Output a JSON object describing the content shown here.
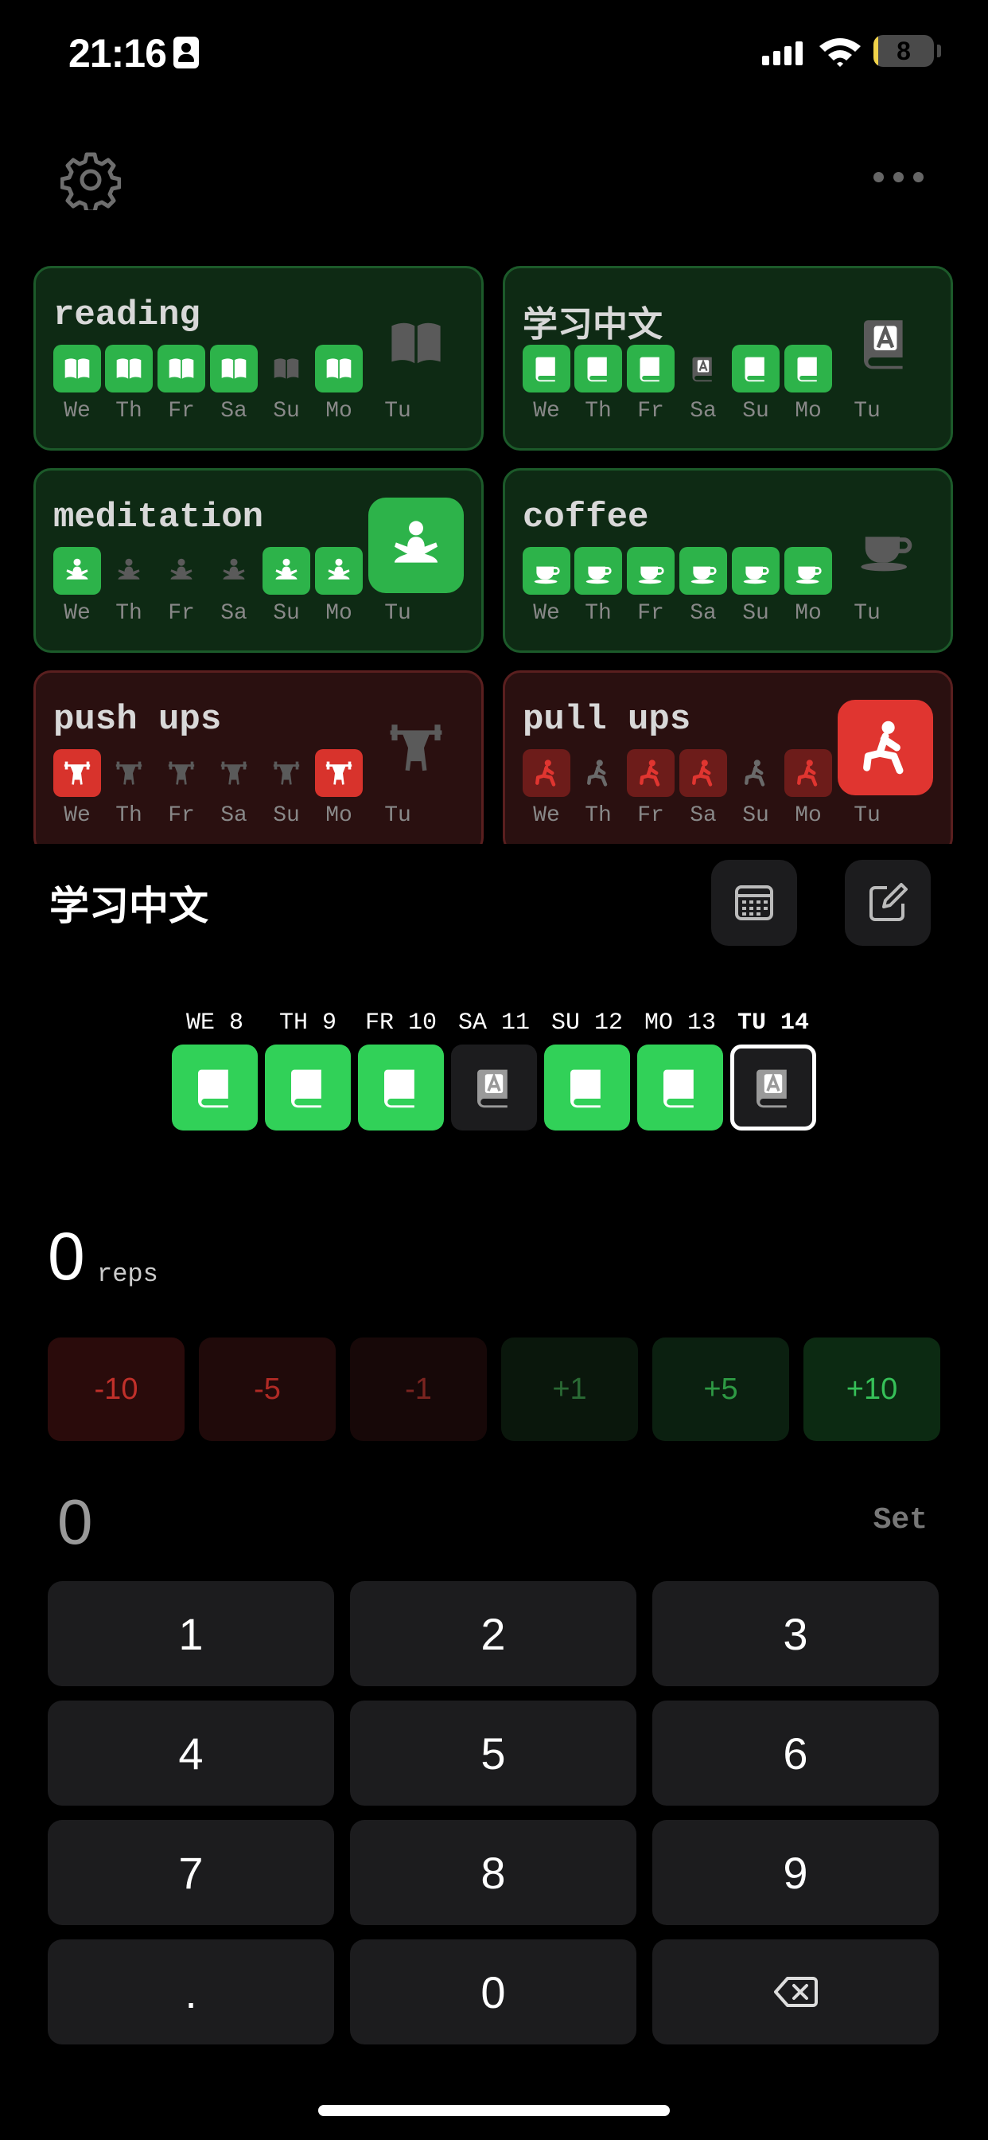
{
  "status_bar": {
    "time": "21:16",
    "battery": "8",
    "battery_level_percent": 8
  },
  "habits": [
    {
      "title": "reading",
      "theme": "green",
      "icon": "book-open-icon",
      "days": [
        {
          "label": "We",
          "done": true
        },
        {
          "label": "Th",
          "done": true
        },
        {
          "label": "Fr",
          "done": true
        },
        {
          "label": "Sa",
          "done": true
        },
        {
          "label": "Su",
          "done": false
        },
        {
          "label": "Mo",
          "done": true
        }
      ],
      "today": {
        "label": "Tu",
        "done": false
      }
    },
    {
      "title": "学习中文",
      "theme": "green",
      "icon": "dictionary-book-icon",
      "days": [
        {
          "label": "We",
          "done": true
        },
        {
          "label": "Th",
          "done": true
        },
        {
          "label": "Fr",
          "done": true
        },
        {
          "label": "Sa",
          "done": false
        },
        {
          "label": "Su",
          "done": true
        },
        {
          "label": "Mo",
          "done": true
        }
      ],
      "today": {
        "label": "Tu",
        "done": false
      }
    },
    {
      "title": "meditation",
      "theme": "green",
      "icon": "meditation-icon",
      "days": [
        {
          "label": "We",
          "done": true
        },
        {
          "label": "Th",
          "done": false
        },
        {
          "label": "Fr",
          "done": false
        },
        {
          "label": "Sa",
          "done": false
        },
        {
          "label": "Su",
          "done": true
        },
        {
          "label": "Mo",
          "done": true
        }
      ],
      "today": {
        "label": "Tu",
        "done": true
      }
    },
    {
      "title": "coffee",
      "theme": "green",
      "icon": "coffee-cup-icon",
      "days": [
        {
          "label": "We",
          "done": true
        },
        {
          "label": "Th",
          "done": true
        },
        {
          "label": "Fr",
          "done": true
        },
        {
          "label": "Sa",
          "done": true
        },
        {
          "label": "Su",
          "done": true
        },
        {
          "label": "Mo",
          "done": true
        }
      ],
      "today": {
        "label": "Tu",
        "done": false
      }
    },
    {
      "title": "push ups",
      "theme": "red",
      "icon": "weightlifter-icon",
      "days": [
        {
          "label": "We",
          "done": true
        },
        {
          "label": "Th",
          "done": false
        },
        {
          "label": "Fr",
          "done": false
        },
        {
          "label": "Sa",
          "done": false
        },
        {
          "label": "Su",
          "done": false
        },
        {
          "label": "Mo",
          "done": true
        }
      ],
      "today": {
        "label": "Tu",
        "done": false
      }
    },
    {
      "title": "pull ups",
      "theme": "red",
      "icon": "lunge-exercise-icon",
      "days": [
        {
          "label": "We",
          "done": "partial"
        },
        {
          "label": "Th",
          "done": false
        },
        {
          "label": "Fr",
          "done": "partial"
        },
        {
          "label": "Sa",
          "done": "partial"
        },
        {
          "label": "Su",
          "done": false
        },
        {
          "label": "Mo",
          "done": "partial"
        }
      ],
      "today": {
        "label": "Tu",
        "done": true
      }
    }
  ],
  "detail": {
    "title": "学习中文",
    "calendar_icon": "calendar-icon",
    "edit_icon": "edit-icon",
    "week": [
      {
        "label": "WE  8",
        "done": true
      },
      {
        "label": "TH  9",
        "done": true
      },
      {
        "label": "FR 10",
        "done": true
      },
      {
        "label": "SA 11",
        "done": false
      },
      {
        "label": "SU 12",
        "done": true
      },
      {
        "label": "MO 13",
        "done": true
      },
      {
        "label": "TU 14",
        "done": false,
        "current": true
      }
    ],
    "count": "0",
    "unit": "reps",
    "steps": [
      "-10",
      "-5",
      "-1",
      "+1",
      "+5",
      "+10"
    ],
    "input_value": "0",
    "set_label": "Set",
    "keypad": [
      "1",
      "2",
      "3",
      "4",
      "5",
      "6",
      "7",
      "8",
      "9",
      ".",
      "0"
    ],
    "backspace_icon": "backspace-icon"
  },
  "colors": {
    "green_on": "#2db34a",
    "green_bright": "#31d158",
    "red_on": "#d8332c",
    "card_green_bg": "#0e2a14",
    "card_red_bg": "#2a1010"
  }
}
